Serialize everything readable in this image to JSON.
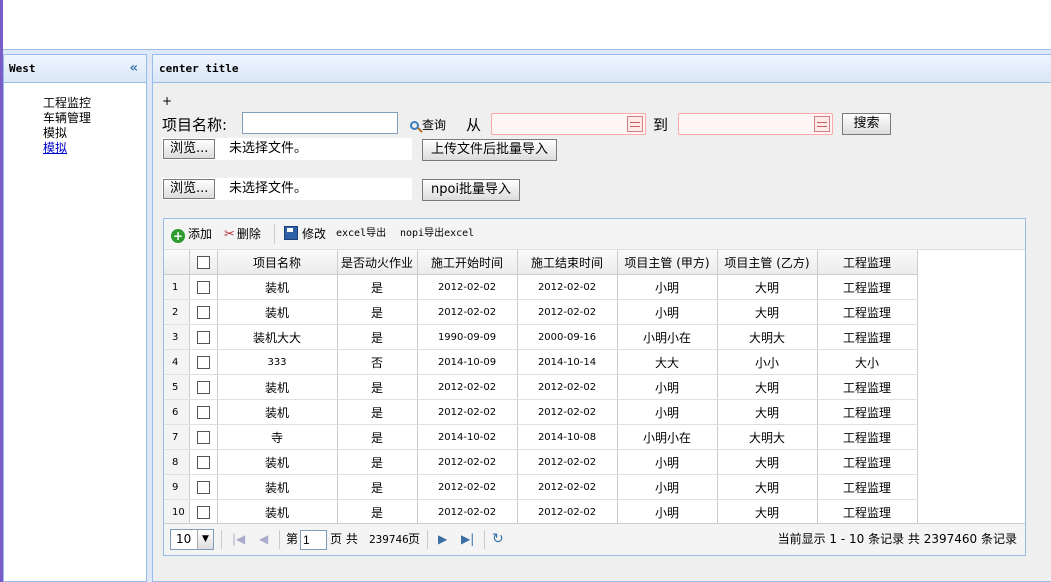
{
  "west": {
    "title": "West",
    "collapse_icon": "double-chevron-left-icon",
    "nav_items": [
      "工程监控",
      "车辆管理",
      "模拟",
      "模拟"
    ]
  },
  "center": {
    "title": "center title",
    "plus": "+",
    "form": {
      "name_label": "项目名称:",
      "name_value": "",
      "query_label": "查询",
      "from_label": "从",
      "to_label": "到",
      "search_label": "搜索",
      "browse_label": "浏览...",
      "file_none": "未选择文件。",
      "upload_label": "上传文件后批量导入",
      "npoi_import_label": "npoi批量导入"
    },
    "toolbar": {
      "add": "添加",
      "delete": "删除",
      "edit": "修改",
      "excel_export": "excel导出",
      "npoi_export": "nopi导出excel"
    },
    "columns": [
      "项目名称",
      "是否动火作业",
      "施工开始时间",
      "施工结束时间",
      "项目主管 (甲方)",
      "项目主管 (乙方)",
      "工程监理"
    ],
    "rows": [
      {
        "n": "1",
        "name": "装机",
        "fire": "是",
        "start": "2012-02-02",
        "end": "2012-02-02",
        "a": "小明",
        "b": "大明",
        "sup": "工程监理"
      },
      {
        "n": "2",
        "name": "装机",
        "fire": "是",
        "start": "2012-02-02",
        "end": "2012-02-02",
        "a": "小明",
        "b": "大明",
        "sup": "工程监理"
      },
      {
        "n": "3",
        "name": "装机大大",
        "fire": "是",
        "start": "1990-09-09",
        "end": "2000-09-16",
        "a": "小明小在",
        "b": "大明大",
        "sup": "工程监理"
      },
      {
        "n": "4",
        "name": "333",
        "fire": "否",
        "start": "2014-10-09",
        "end": "2014-10-14",
        "a": "大大",
        "b": "小小",
        "sup": "大小"
      },
      {
        "n": "5",
        "name": "装机",
        "fire": "是",
        "start": "2012-02-02",
        "end": "2012-02-02",
        "a": "小明",
        "b": "大明",
        "sup": "工程监理"
      },
      {
        "n": "6",
        "name": "装机",
        "fire": "是",
        "start": "2012-02-02",
        "end": "2012-02-02",
        "a": "小明",
        "b": "大明",
        "sup": "工程监理"
      },
      {
        "n": "7",
        "name": "寺",
        "fire": "是",
        "start": "2014-10-02",
        "end": "2014-10-08",
        "a": "小明小在",
        "b": "大明大",
        "sup": "工程监理"
      },
      {
        "n": "8",
        "name": "装机",
        "fire": "是",
        "start": "2012-02-02",
        "end": "2012-02-02",
        "a": "小明",
        "b": "大明",
        "sup": "工程监理"
      },
      {
        "n": "9",
        "name": "装机",
        "fire": "是",
        "start": "2012-02-02",
        "end": "2012-02-02",
        "a": "小明",
        "b": "大明",
        "sup": "工程监理"
      },
      {
        "n": "10",
        "name": "装机",
        "fire": "是",
        "start": "2012-02-02",
        "end": "2012-02-02",
        "a": "小明",
        "b": "大明",
        "sup": "工程监理"
      }
    ],
    "pager": {
      "page_size": "10",
      "page_prefix": "第",
      "page_value": "1",
      "page_mid": "页 共",
      "total_pages": "239746",
      "page_suffix": "页",
      "summary": "当前显示 1 - 10 条记录 共 2397460 条记录"
    }
  },
  "colors": {
    "panel_border": "#99bbe8",
    "layout_bg": "#dfe8f6",
    "link": "#0000cc",
    "date_border": "#ffa8a8"
  }
}
